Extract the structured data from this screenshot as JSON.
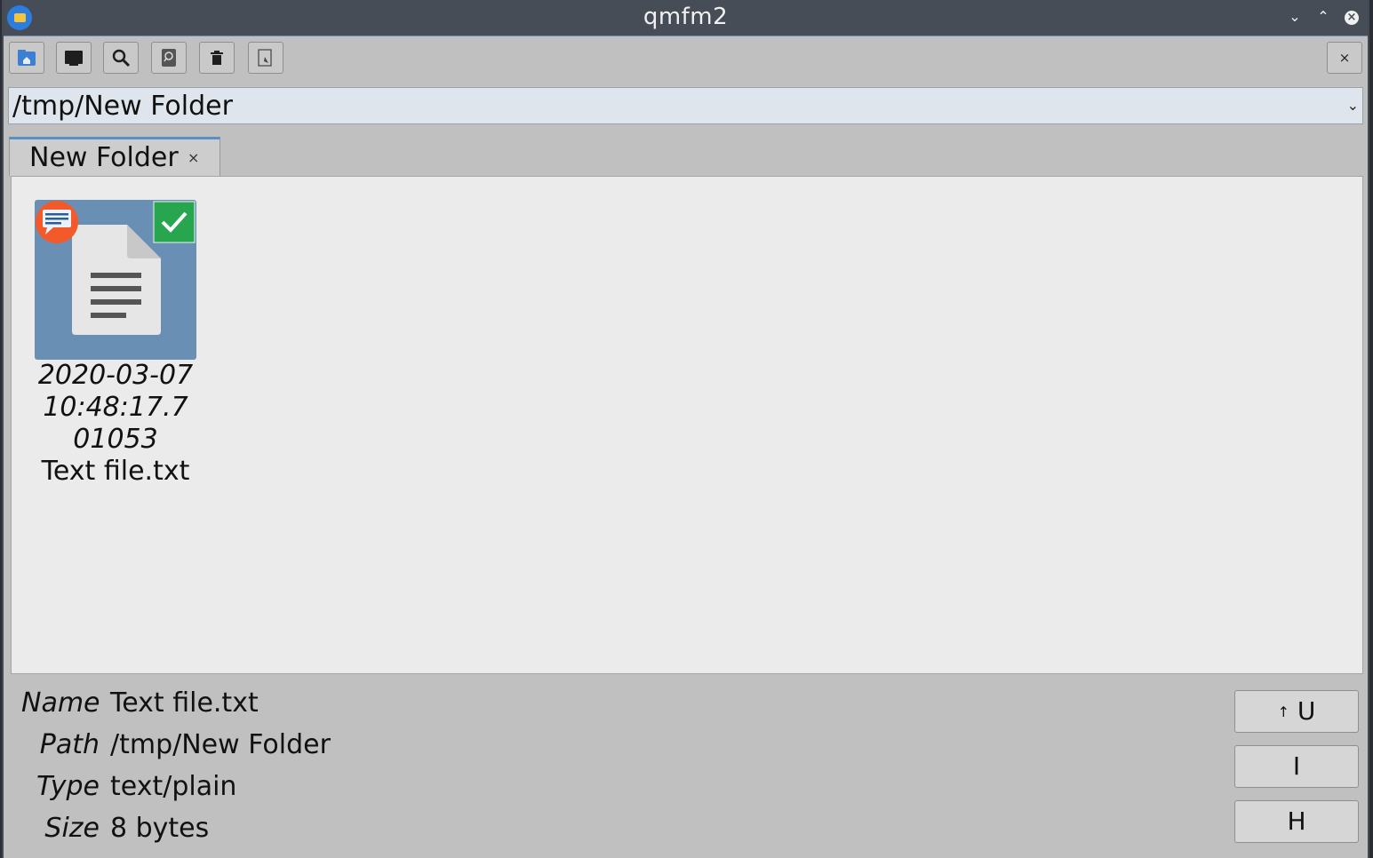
{
  "window": {
    "title": "qmfm2"
  },
  "toolbar": {
    "buttons": [
      {
        "icon": "home-folder-icon"
      },
      {
        "icon": "terminal-icon"
      },
      {
        "icon": "search-icon"
      },
      {
        "icon": "find-icon"
      },
      {
        "icon": "trash-icon"
      },
      {
        "icon": "rename-icon"
      }
    ],
    "close_label": "×"
  },
  "path_combo": {
    "value": "/tmp/New Folder",
    "arrow": "⌄"
  },
  "tab": {
    "label": "New Folder",
    "close": "×"
  },
  "files": [
    {
      "date": "2020-03-07",
      "time1": "10:48:17.7",
      "time2": "01053",
      "name": "Text file.txt",
      "selected": true
    }
  ],
  "info": {
    "name_key": "Name",
    "name_value": "Text file.txt",
    "path_key": "Path",
    "path_value": "/tmp/New Folder",
    "type_key": "Type",
    "type_value": "text/plain",
    "size_key": "Size",
    "size_value": "8 bytes"
  },
  "side_buttons": {
    "up_arrow": "↑",
    "up_label": "U",
    "info_label": "I",
    "hidden_label": "H"
  },
  "colors": {
    "accent": "#5b8fc6",
    "selection": "#6a8fb5",
    "check": "#27a64f",
    "badge": "#f25a2b"
  }
}
